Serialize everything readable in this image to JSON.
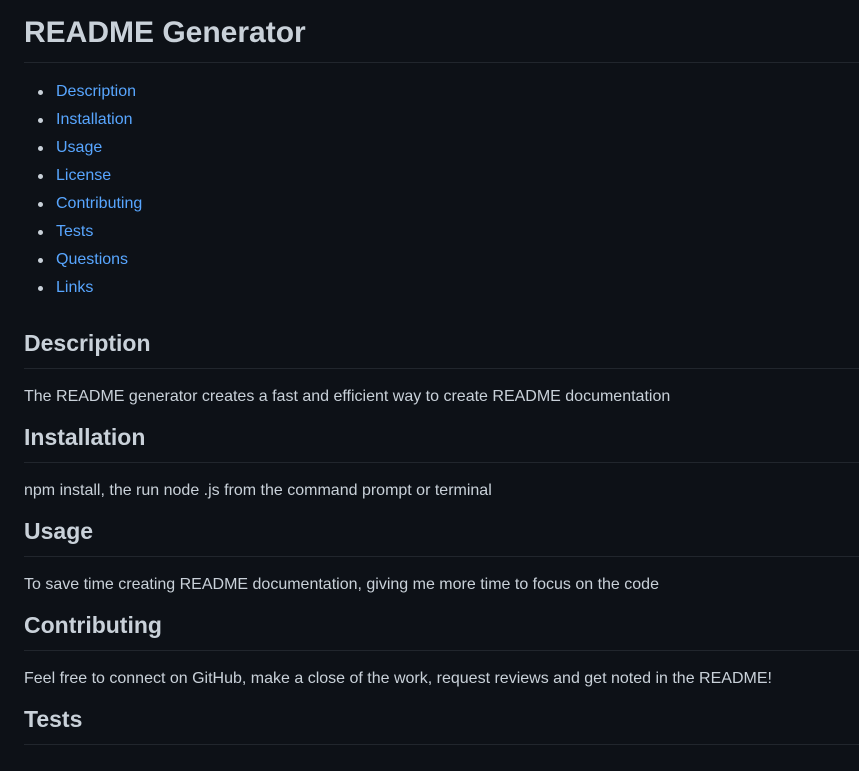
{
  "title": "README Generator",
  "toc": [
    {
      "label": "Description"
    },
    {
      "label": "Installation"
    },
    {
      "label": "Usage"
    },
    {
      "label": "License"
    },
    {
      "label": "Contributing"
    },
    {
      "label": "Tests"
    },
    {
      "label": "Questions"
    },
    {
      "label": "Links"
    }
  ],
  "sections": {
    "description": {
      "heading": "Description",
      "text": "The README generator creates a fast and efficient way to create README documentation"
    },
    "installation": {
      "heading": "Installation",
      "text": "npm install, the run node .js from the command prompt or terminal"
    },
    "usage": {
      "heading": "Usage",
      "text": "To save time creating README documentation, giving me more time to focus on the code"
    },
    "contributing": {
      "heading": "Contributing",
      "text": "Feel free to connect on GitHub, make a close of the work, request reviews and get noted in the README!"
    },
    "tests": {
      "heading": "Tests"
    }
  },
  "colors": {
    "background": "#0d1117",
    "text": "#c9d1d9",
    "link": "#58a6ff",
    "rule": "#21262d"
  }
}
